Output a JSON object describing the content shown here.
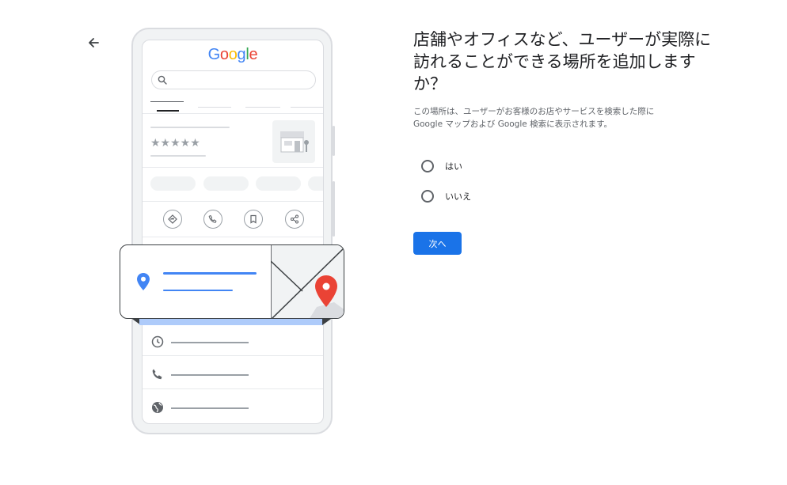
{
  "nav": {
    "back_icon": "arrow-back-icon"
  },
  "illustration": {
    "brand_letters": [
      {
        "ch": "G",
        "color": "#4285F4"
      },
      {
        "ch": "o",
        "color": "#EA4335"
      },
      {
        "ch": "o",
        "color": "#FBBC05"
      },
      {
        "ch": "g",
        "color": "#4285F4"
      },
      {
        "ch": "l",
        "color": "#34A853"
      },
      {
        "ch": "e",
        "color": "#EA4335"
      }
    ],
    "stars": "★★★★★",
    "action_icons": [
      "directions-icon",
      "phone-icon",
      "bookmark-icon",
      "share-icon"
    ],
    "info_icons": [
      "clock-icon",
      "phone-icon",
      "globe-icon"
    ],
    "accent_blue": "#4285F4",
    "pin_red": "#EA4335"
  },
  "question": {
    "title": "店舗やオフィスなど、ユーザーが実際に訪れることができる場所を追加しますか？",
    "description": "この場所は、ユーザーがお客様のお店やサービスを検索した際にGoogle マップおよび Google 検索に表示されます。",
    "options": [
      {
        "label": "はい",
        "selected": false
      },
      {
        "label": "いいえ",
        "selected": false
      }
    ],
    "next_label": "次へ",
    "primary_color": "#1a73e8"
  }
}
